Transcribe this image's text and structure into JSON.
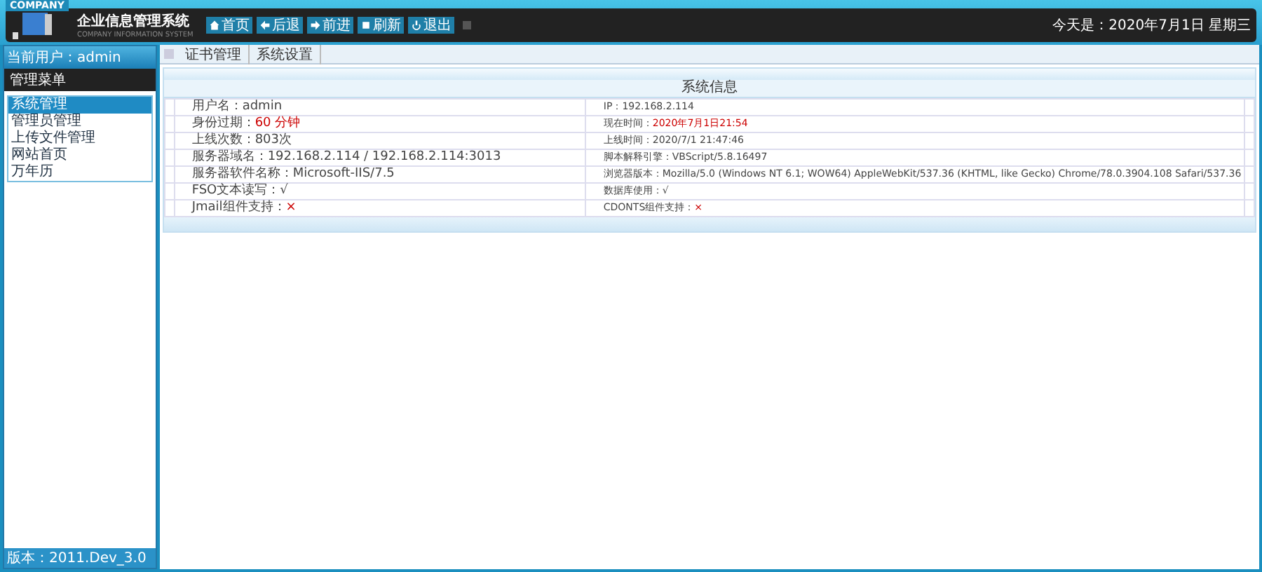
{
  "header": {
    "badge": "COMPANY",
    "title": "企业信息管理系统",
    "subtitle": "COMPANY INFORMATION SYSTEM",
    "nav": [
      {
        "label": "首页"
      },
      {
        "label": "后退"
      },
      {
        "label": "前进"
      },
      {
        "label": "刷新"
      },
      {
        "label": "退出"
      }
    ],
    "date": "今天是：2020年7月1日 星期三"
  },
  "sidebar": {
    "user": "当前用户：admin",
    "menu_title": "管理菜单",
    "items": [
      {
        "label": "系统管理",
        "selected": true
      },
      {
        "label": "管理员管理",
        "selected": false
      },
      {
        "label": "上传文件管理",
        "selected": false
      },
      {
        "label": "网站首页",
        "selected": false
      },
      {
        "label": "万年历",
        "selected": false
      }
    ],
    "footer": "版本：2011.Dev_3.0"
  },
  "tabs": [
    {
      "label": "证书管理",
      "selected": false
    },
    {
      "label": "系统设置",
      "selected": false
    }
  ],
  "panel": {
    "title": "系统信息",
    "rows": [
      [
        {
          "label": "用户名：",
          "value": "admin",
          "highlight": false
        },
        {
          "label": "IP：",
          "value": "192.168.2.114",
          "highlight": false
        }
      ],
      [
        {
          "label": "身份过期：",
          "value": "60 分钟",
          "highlight": true
        },
        {
          "label": "现在时间：",
          "value": "2020年7月1日21:54",
          "highlight": true
        }
      ],
      [
        {
          "label": "上线次数：",
          "value": "803次",
          "highlight": false
        },
        {
          "label": "上线时间：",
          "value": "2020/7/1 21:47:46",
          "highlight": false
        }
      ],
      [
        {
          "label": "服务器域名：",
          "value": "192.168.2.114 / 192.168.2.114:3013",
          "highlight": false
        },
        {
          "label": "脚本解释引擎：",
          "value": "VBScript/5.8.16497",
          "highlight": false
        }
      ],
      [
        {
          "label": "服务器软件名称：",
          "value": "Microsoft-IIS/7.5",
          "highlight": false
        },
        {
          "label": "浏览器版本：",
          "value": "Mozilla/5.0 (Windows NT 6.1; WOW64) AppleWebKit/537.36 (KHTML, like Gecko) Chrome/78.0.3904.108 Safari/537.36",
          "highlight": false
        }
      ],
      [
        {
          "label": "FSO文本读写：",
          "value": "√",
          "highlight": false
        },
        {
          "label": "数据库使用：",
          "value": "√",
          "highlight": false
        }
      ],
      [
        {
          "label": "Jmail组件支持：",
          "value": "×",
          "highlight": true
        },
        {
          "label": "CDONTS组件支持：",
          "value": "×",
          "highlight": true
        }
      ]
    ]
  }
}
